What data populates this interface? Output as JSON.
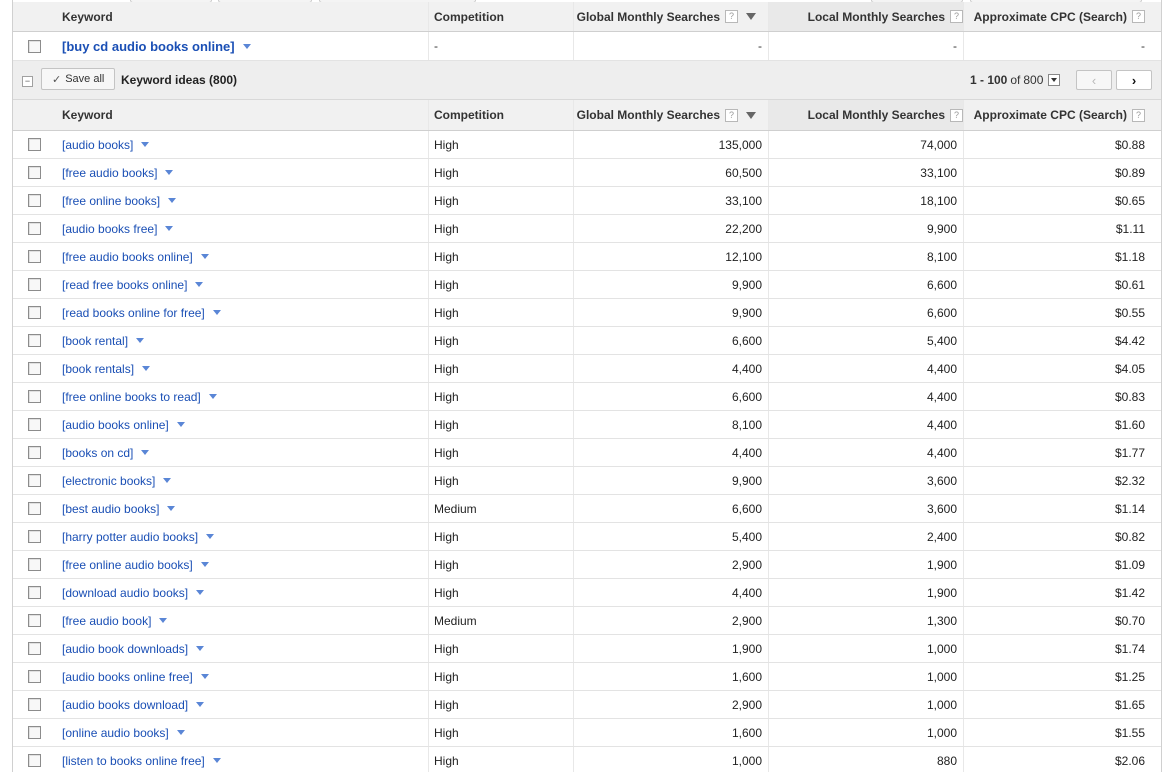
{
  "columns": {
    "keyword": "Keyword",
    "competition": "Competition",
    "global": "Global Monthly Searches",
    "local": "Local Monthly Searches",
    "cpc": "Approximate CPC (Search)",
    "help": "?"
  },
  "seed": {
    "keyword": "[buy cd audio books online]",
    "competition": "-",
    "global": "-",
    "local": "-",
    "cpc": "-"
  },
  "group": {
    "save_all": "Save all",
    "title": "Keyword ideas (800)",
    "range": "1 - 100",
    "of_label": "of",
    "total": "800"
  },
  "icons": {
    "checkbox": "checkbox-icon",
    "dropdown": "dropdown-caret-icon",
    "sort": "sort-desc-icon",
    "collapse": "collapse-minus-icon",
    "check": "checkmark-icon",
    "prev": "chevron-left-icon",
    "next": "chevron-right-icon"
  },
  "colors": {
    "link": "#1a4fb5",
    "header_bg": "#f1f1f1",
    "group_bg": "#eeeeee"
  },
  "rows": [
    {
      "keyword": "[audio books]",
      "competition": "High",
      "global": "135,000",
      "local": "74,000",
      "cpc": "$0.88"
    },
    {
      "keyword": "[free audio books]",
      "competition": "High",
      "global": "60,500",
      "local": "33,100",
      "cpc": "$0.89"
    },
    {
      "keyword": "[free online books]",
      "competition": "High",
      "global": "33,100",
      "local": "18,100",
      "cpc": "$0.65"
    },
    {
      "keyword": "[audio books free]",
      "competition": "High",
      "global": "22,200",
      "local": "9,900",
      "cpc": "$1.11"
    },
    {
      "keyword": "[free audio books online]",
      "competition": "High",
      "global": "12,100",
      "local": "8,100",
      "cpc": "$1.18"
    },
    {
      "keyword": "[read free books online]",
      "competition": "High",
      "global": "9,900",
      "local": "6,600",
      "cpc": "$0.61"
    },
    {
      "keyword": "[read books online for free]",
      "competition": "High",
      "global": "9,900",
      "local": "6,600",
      "cpc": "$0.55"
    },
    {
      "keyword": "[book rental]",
      "competition": "High",
      "global": "6,600",
      "local": "5,400",
      "cpc": "$4.42"
    },
    {
      "keyword": "[book rentals]",
      "competition": "High",
      "global": "4,400",
      "local": "4,400",
      "cpc": "$4.05"
    },
    {
      "keyword": "[free online books to read]",
      "competition": "High",
      "global": "6,600",
      "local": "4,400",
      "cpc": "$0.83"
    },
    {
      "keyword": "[audio books online]",
      "competition": "High",
      "global": "8,100",
      "local": "4,400",
      "cpc": "$1.60"
    },
    {
      "keyword": "[books on cd]",
      "competition": "High",
      "global": "4,400",
      "local": "4,400",
      "cpc": "$1.77"
    },
    {
      "keyword": "[electronic books]",
      "competition": "High",
      "global": "9,900",
      "local": "3,600",
      "cpc": "$2.32"
    },
    {
      "keyword": "[best audio books]",
      "competition": "Medium",
      "global": "6,600",
      "local": "3,600",
      "cpc": "$1.14"
    },
    {
      "keyword": "[harry potter audio books]",
      "competition": "High",
      "global": "5,400",
      "local": "2,400",
      "cpc": "$0.82"
    },
    {
      "keyword": "[free online audio books]",
      "competition": "High",
      "global": "2,900",
      "local": "1,900",
      "cpc": "$1.09"
    },
    {
      "keyword": "[download audio books]",
      "competition": "High",
      "global": "4,400",
      "local": "1,900",
      "cpc": "$1.42"
    },
    {
      "keyword": "[free audio book]",
      "competition": "Medium",
      "global": "2,900",
      "local": "1,300",
      "cpc": "$0.70"
    },
    {
      "keyword": "[audio book downloads]",
      "competition": "High",
      "global": "1,900",
      "local": "1,000",
      "cpc": "$1.74"
    },
    {
      "keyword": "[audio books online free]",
      "competition": "High",
      "global": "1,600",
      "local": "1,000",
      "cpc": "$1.25"
    },
    {
      "keyword": "[audio books download]",
      "competition": "High",
      "global": "2,900",
      "local": "1,000",
      "cpc": "$1.65"
    },
    {
      "keyword": "[online audio books]",
      "competition": "High",
      "global": "1,600",
      "local": "1,000",
      "cpc": "$1.55"
    },
    {
      "keyword": "[listen to books online free]",
      "competition": "High",
      "global": "1,000",
      "local": "880",
      "cpc": "$2.06"
    }
  ]
}
